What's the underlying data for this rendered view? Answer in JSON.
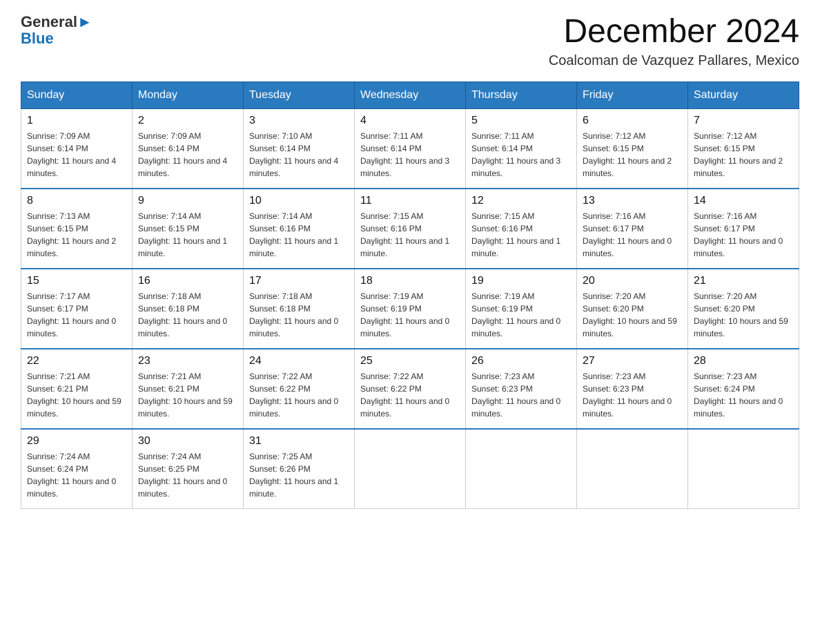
{
  "header": {
    "logo_text_general": "General",
    "logo_text_blue": "Blue",
    "month_title": "December 2024",
    "location": "Coalcoman de Vazquez Pallares, Mexico"
  },
  "weekdays": [
    "Sunday",
    "Monday",
    "Tuesday",
    "Wednesday",
    "Thursday",
    "Friday",
    "Saturday"
  ],
  "weeks": [
    [
      {
        "day": "1",
        "sunrise": "7:09 AM",
        "sunset": "6:14 PM",
        "daylight": "11 hours and 4 minutes."
      },
      {
        "day": "2",
        "sunrise": "7:09 AM",
        "sunset": "6:14 PM",
        "daylight": "11 hours and 4 minutes."
      },
      {
        "day": "3",
        "sunrise": "7:10 AM",
        "sunset": "6:14 PM",
        "daylight": "11 hours and 4 minutes."
      },
      {
        "day": "4",
        "sunrise": "7:11 AM",
        "sunset": "6:14 PM",
        "daylight": "11 hours and 3 minutes."
      },
      {
        "day": "5",
        "sunrise": "7:11 AM",
        "sunset": "6:14 PM",
        "daylight": "11 hours and 3 minutes."
      },
      {
        "day": "6",
        "sunrise": "7:12 AM",
        "sunset": "6:15 PM",
        "daylight": "11 hours and 2 minutes."
      },
      {
        "day": "7",
        "sunrise": "7:12 AM",
        "sunset": "6:15 PM",
        "daylight": "11 hours and 2 minutes."
      }
    ],
    [
      {
        "day": "8",
        "sunrise": "7:13 AM",
        "sunset": "6:15 PM",
        "daylight": "11 hours and 2 minutes."
      },
      {
        "day": "9",
        "sunrise": "7:14 AM",
        "sunset": "6:15 PM",
        "daylight": "11 hours and 1 minute."
      },
      {
        "day": "10",
        "sunrise": "7:14 AM",
        "sunset": "6:16 PM",
        "daylight": "11 hours and 1 minute."
      },
      {
        "day": "11",
        "sunrise": "7:15 AM",
        "sunset": "6:16 PM",
        "daylight": "11 hours and 1 minute."
      },
      {
        "day": "12",
        "sunrise": "7:15 AM",
        "sunset": "6:16 PM",
        "daylight": "11 hours and 1 minute."
      },
      {
        "day": "13",
        "sunrise": "7:16 AM",
        "sunset": "6:17 PM",
        "daylight": "11 hours and 0 minutes."
      },
      {
        "day": "14",
        "sunrise": "7:16 AM",
        "sunset": "6:17 PM",
        "daylight": "11 hours and 0 minutes."
      }
    ],
    [
      {
        "day": "15",
        "sunrise": "7:17 AM",
        "sunset": "6:17 PM",
        "daylight": "11 hours and 0 minutes."
      },
      {
        "day": "16",
        "sunrise": "7:18 AM",
        "sunset": "6:18 PM",
        "daylight": "11 hours and 0 minutes."
      },
      {
        "day": "17",
        "sunrise": "7:18 AM",
        "sunset": "6:18 PM",
        "daylight": "11 hours and 0 minutes."
      },
      {
        "day": "18",
        "sunrise": "7:19 AM",
        "sunset": "6:19 PM",
        "daylight": "11 hours and 0 minutes."
      },
      {
        "day": "19",
        "sunrise": "7:19 AM",
        "sunset": "6:19 PM",
        "daylight": "11 hours and 0 minutes."
      },
      {
        "day": "20",
        "sunrise": "7:20 AM",
        "sunset": "6:20 PM",
        "daylight": "10 hours and 59 minutes."
      },
      {
        "day": "21",
        "sunrise": "7:20 AM",
        "sunset": "6:20 PM",
        "daylight": "10 hours and 59 minutes."
      }
    ],
    [
      {
        "day": "22",
        "sunrise": "7:21 AM",
        "sunset": "6:21 PM",
        "daylight": "10 hours and 59 minutes."
      },
      {
        "day": "23",
        "sunrise": "7:21 AM",
        "sunset": "6:21 PM",
        "daylight": "10 hours and 59 minutes."
      },
      {
        "day": "24",
        "sunrise": "7:22 AM",
        "sunset": "6:22 PM",
        "daylight": "11 hours and 0 minutes."
      },
      {
        "day": "25",
        "sunrise": "7:22 AM",
        "sunset": "6:22 PM",
        "daylight": "11 hours and 0 minutes."
      },
      {
        "day": "26",
        "sunrise": "7:23 AM",
        "sunset": "6:23 PM",
        "daylight": "11 hours and 0 minutes."
      },
      {
        "day": "27",
        "sunrise": "7:23 AM",
        "sunset": "6:23 PM",
        "daylight": "11 hours and 0 minutes."
      },
      {
        "day": "28",
        "sunrise": "7:23 AM",
        "sunset": "6:24 PM",
        "daylight": "11 hours and 0 minutes."
      }
    ],
    [
      {
        "day": "29",
        "sunrise": "7:24 AM",
        "sunset": "6:24 PM",
        "daylight": "11 hours and 0 minutes."
      },
      {
        "day": "30",
        "sunrise": "7:24 AM",
        "sunset": "6:25 PM",
        "daylight": "11 hours and 0 minutes."
      },
      {
        "day": "31",
        "sunrise": "7:25 AM",
        "sunset": "6:26 PM",
        "daylight": "11 hours and 1 minute."
      },
      null,
      null,
      null,
      null
    ]
  ],
  "labels": {
    "sunrise": "Sunrise:",
    "sunset": "Sunset:",
    "daylight": "Daylight:"
  }
}
